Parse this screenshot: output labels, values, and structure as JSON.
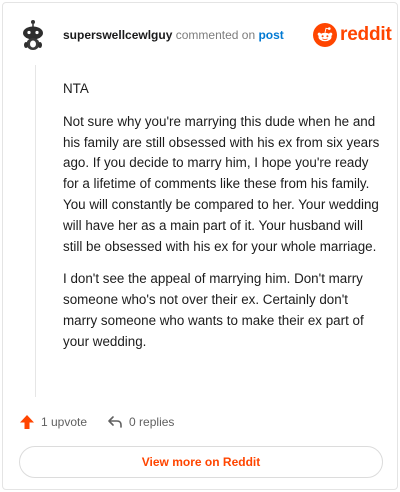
{
  "comment": {
    "username": "superswellcewlguy",
    "action_text": "commented on",
    "post_link": "post",
    "paragraphs": [
      "NTA",
      "Not sure why you're marrying this dude when he and his family are still obsessed with his ex from six years ago. If you decide to marry him, I hope you're ready for a lifetime of comments like these from his family. You will constantly be compared to her. Your wedding will have her as a main part of it. Your husband will still be obsessed with his ex for your whole marriage.",
      "I don't see the appeal of marrying him. Don't marry someone who's not over their ex. Certainly don't marry someone who wants to make their ex part of your wedding."
    ]
  },
  "brand": {
    "name": "reddit",
    "color": "#ff4500"
  },
  "footer": {
    "upvote_label": "1 upvote",
    "replies_label": "0 replies",
    "upvote_icon": "upvote-arrow-icon",
    "reply_icon": "reply-arrow-icon"
  },
  "view_more_label": "View more on Reddit",
  "colors": {
    "accent": "#ff4500",
    "link": "#0079d3",
    "muted": "#7c7c7c"
  }
}
